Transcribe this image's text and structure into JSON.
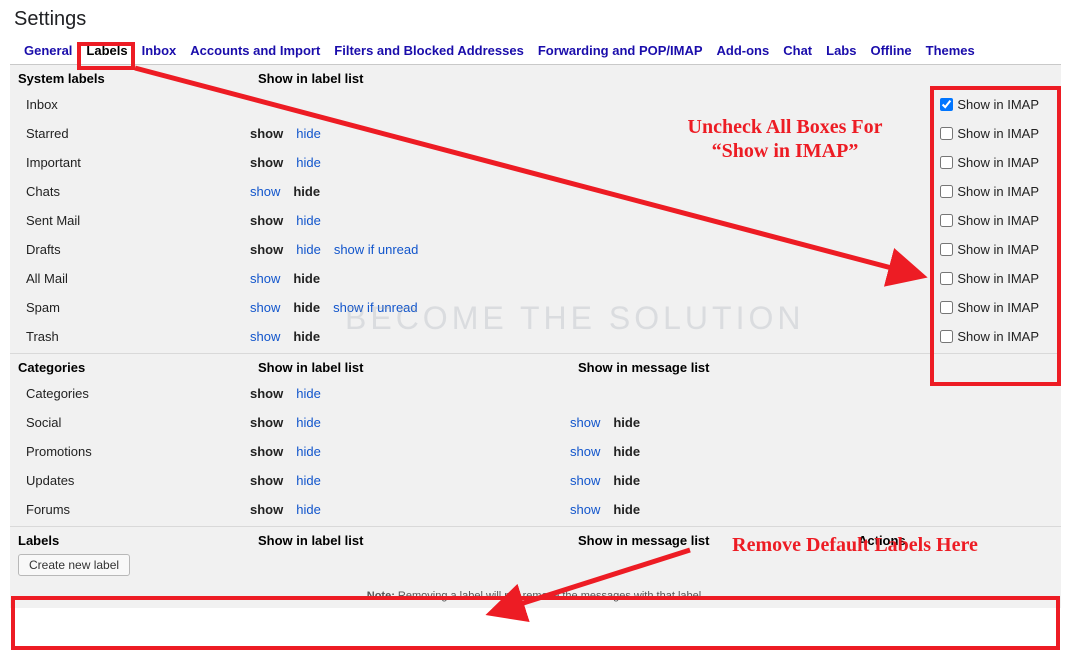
{
  "page_title": "Settings",
  "tabs": [
    {
      "label": "General",
      "active": false
    },
    {
      "label": "Labels",
      "active": true
    },
    {
      "label": "Inbox",
      "active": false
    },
    {
      "label": "Accounts and Import",
      "active": false
    },
    {
      "label": "Filters and Blocked Addresses",
      "active": false
    },
    {
      "label": "Forwarding and POP/IMAP",
      "active": false
    },
    {
      "label": "Add-ons",
      "active": false
    },
    {
      "label": "Chat",
      "active": false
    },
    {
      "label": "Labs",
      "active": false
    },
    {
      "label": "Offline",
      "active": false
    },
    {
      "label": "Themes",
      "active": false
    }
  ],
  "headers": {
    "system_labels": "System labels",
    "categories": "Categories",
    "labels": "Labels",
    "show_in_label_list": "Show in label list",
    "show_in_message_list": "Show in message list",
    "actions": "Actions"
  },
  "opt_text": {
    "show": "show",
    "hide": "hide",
    "show_if_unread": "show if unread"
  },
  "imap_label": "Show in IMAP",
  "system_rows": [
    {
      "name": "Inbox",
      "label_list": null,
      "imap_checked": true
    },
    {
      "name": "Starred",
      "label_list": {
        "current": "show"
      },
      "imap_checked": false
    },
    {
      "name": "Important",
      "label_list": {
        "current": "show"
      },
      "imap_checked": false
    },
    {
      "name": "Chats",
      "label_list": {
        "current": "hide"
      },
      "imap_checked": false
    },
    {
      "name": "Sent Mail",
      "label_list": {
        "current": "show"
      },
      "imap_checked": false
    },
    {
      "name": "Drafts",
      "label_list": {
        "current": "show",
        "extra": true
      },
      "imap_checked": false
    },
    {
      "name": "All Mail",
      "label_list": {
        "current": "hide"
      },
      "imap_checked": false
    },
    {
      "name": "Spam",
      "label_list": {
        "current": "hide",
        "extra": true
      },
      "imap_checked": false
    },
    {
      "name": "Trash",
      "label_list": {
        "current": "hide"
      },
      "imap_checked": false
    }
  ],
  "category_rows": [
    {
      "name": "Categories",
      "label_list": {
        "current": "show"
      },
      "msg_list": null
    },
    {
      "name": "Social",
      "label_list": {
        "current": "show"
      },
      "msg_list": {
        "current": "hide"
      }
    },
    {
      "name": "Promotions",
      "label_list": {
        "current": "show"
      },
      "msg_list": {
        "current": "hide"
      }
    },
    {
      "name": "Updates",
      "label_list": {
        "current": "show"
      },
      "msg_list": {
        "current": "hide"
      }
    },
    {
      "name": "Forums",
      "label_list": {
        "current": "show"
      },
      "msg_list": {
        "current": "hide"
      }
    }
  ],
  "create_label_button": "Create new label",
  "note": {
    "prefix": "Note:",
    "text": " Removing a label will not remove the messages with that label."
  },
  "annotations": {
    "uncheck": "Uncheck All Boxes For\n“Show in IMAP”",
    "remove": "Remove Default Labels Here"
  },
  "watermark": "BECOME THE SOLUTION"
}
